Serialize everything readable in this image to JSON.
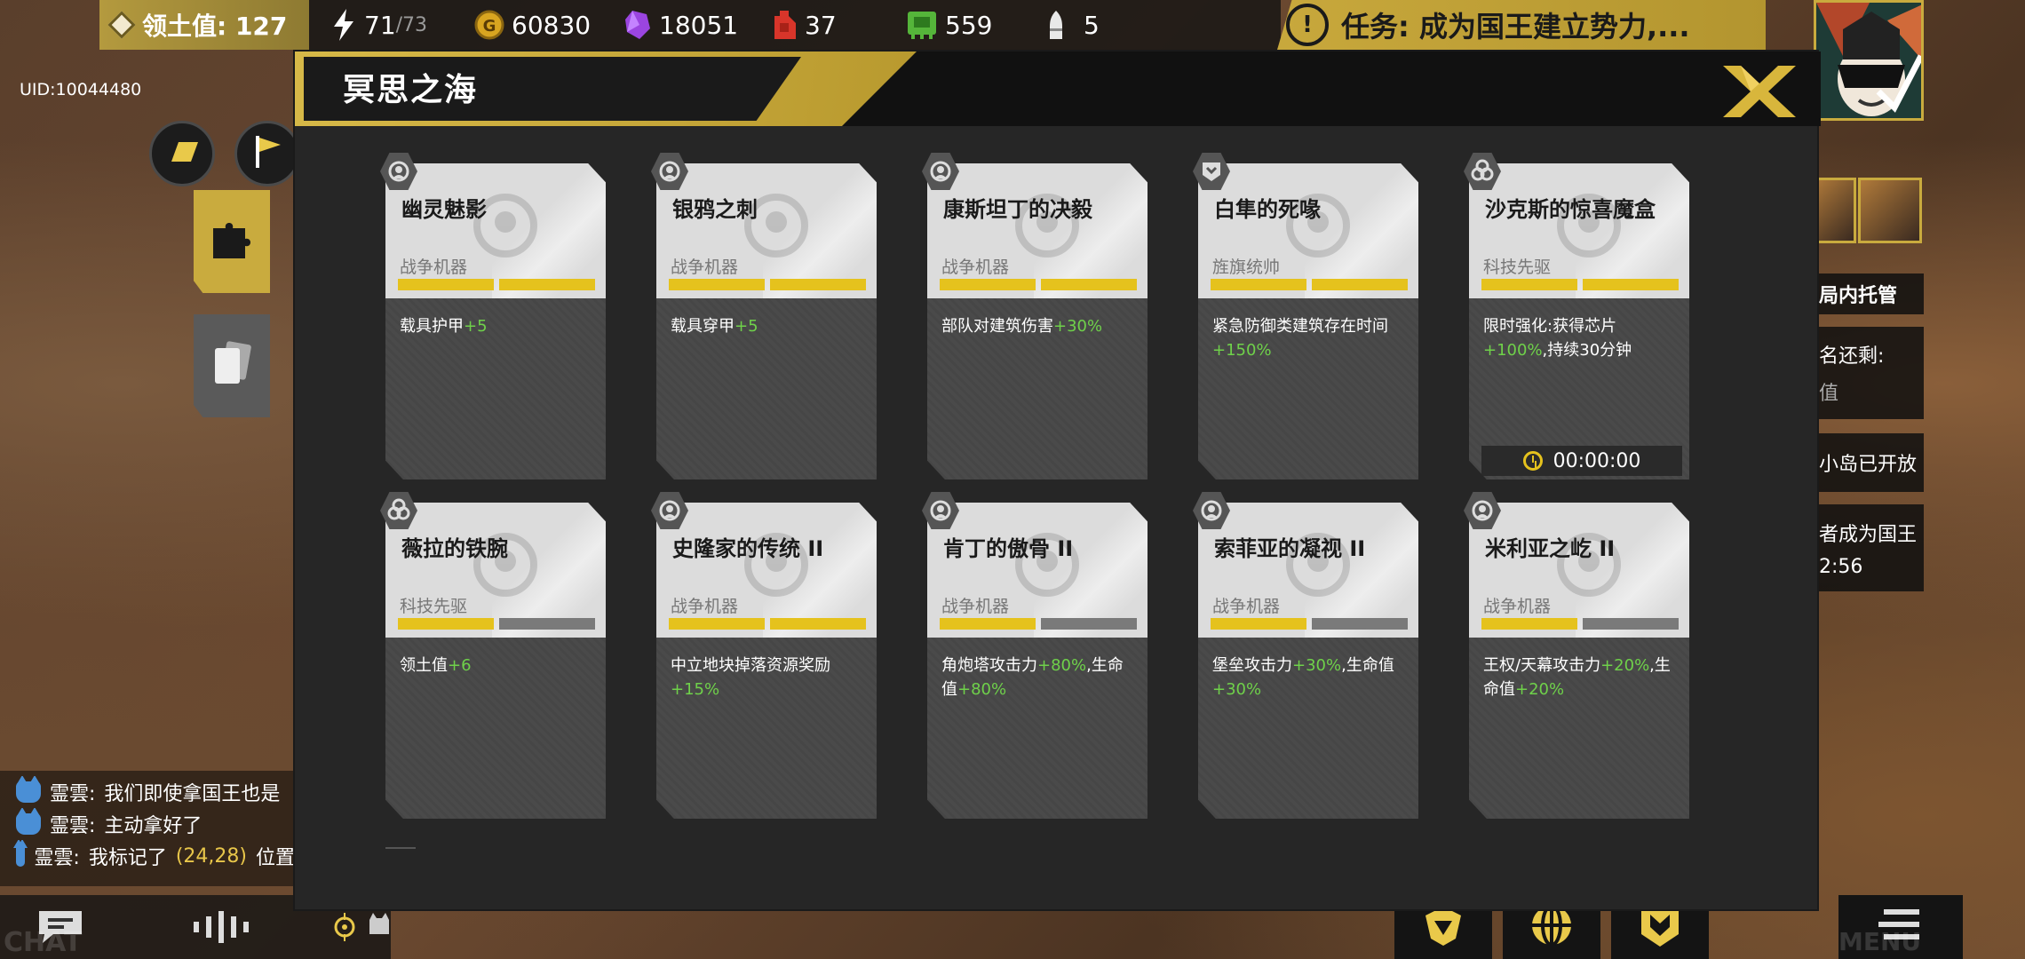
{
  "topbar": {
    "territory_label": "领土值: 127",
    "energy": "71",
    "energy_max": "/73",
    "gold": "60830",
    "crystal": "18051",
    "fuel": "37",
    "chip": "559",
    "ammo": "5",
    "task": "任务: 成为国王建立势力,..."
  },
  "uid": "UID:10044480",
  "chat": [
    {
      "user": "霊雲:",
      "text": "我们即使拿国王也是",
      "highlight": ""
    },
    {
      "user": "霊雲:",
      "text": "主动拿好了",
      "highlight": ""
    },
    {
      "user": "霊雲:",
      "text": "我标记了",
      "highlight": "(24,28)",
      "suffix": "位置"
    }
  ],
  "bottom_left": {
    "chat_label": "CHAT"
  },
  "bottom_right": {
    "menu_label": "MENU"
  },
  "right_panel": {
    "hosting": "局内托管",
    "remaining": "名还剩:",
    "value": "值",
    "island_open": "小岛已开放",
    "become_king": "者成为国王",
    "countdown": "2:56"
  },
  "modal": {
    "title": "冥思之海"
  },
  "cards": [
    {
      "name": "幽灵魅影",
      "type": "战争机器",
      "icon": "gear-bust-icon",
      "level": 2,
      "desc_pre": "载具护甲",
      "bonus": "+5",
      "desc_post": ""
    },
    {
      "name": "银鸦之刺",
      "type": "战争机器",
      "icon": "gear-bust-icon",
      "level": 2,
      "desc_pre": "载具穿甲",
      "bonus": "+5",
      "desc_post": ""
    },
    {
      "name": "康斯坦丁的决毅",
      "type": "战争机器",
      "icon": "gear-bust-icon",
      "level": 2,
      "desc_pre": "部队对建筑伤害",
      "bonus": "+30%",
      "desc_post": ""
    },
    {
      "name": "白隼的死喙",
      "type": "旌旗统帅",
      "icon": "banner-shield-icon",
      "level": 2,
      "desc_pre": "紧急防御类建筑存在时间",
      "bonus": "+150%",
      "desc_post": ""
    },
    {
      "name": "沙克斯的惊喜魔盒",
      "type": "科技先驱",
      "icon": "tech-hex-icon",
      "level": 2,
      "desc_pre": "限时强化:获得芯片",
      "bonus": "+100%",
      "desc_post": ",持续30分钟",
      "timer": "00:00:00"
    },
    {
      "name": "薇拉的铁腕",
      "type": "科技先驱",
      "icon": "tech-hex-icon",
      "level": 1,
      "desc_pre": "领土值",
      "bonus": "+6",
      "desc_post": ""
    },
    {
      "name": "史隆家的传统 II",
      "type": "战争机器",
      "icon": "gear-bust-icon",
      "level": 2,
      "desc_pre": "中立地块掉落资源奖励",
      "bonus": "+15%",
      "desc_post": ""
    },
    {
      "name": "肯丁的傲骨 II",
      "type": "战争机器",
      "icon": "gear-bust-icon",
      "level": 1,
      "desc_pre": "角炮塔攻击力",
      "bonus": "+80%",
      "desc_post": ",生命值",
      "bonus2": "+80%"
    },
    {
      "name": "索菲亚的凝视 II",
      "type": "战争机器",
      "icon": "gear-bust-icon",
      "level": 1,
      "desc_pre": "堡垒攻击力",
      "bonus": "+30%",
      "desc_post": ",生命值",
      "bonus2": "+30%"
    },
    {
      "name": "米利亚之屹 II",
      "type": "战争机器",
      "icon": "gear-bust-icon",
      "level": 1,
      "desc_pre": "王权/天幕攻击力",
      "bonus": "+20%",
      "desc_post": ",生命值",
      "bonus2": "+20%"
    }
  ],
  "colors": {
    "accent": "#e5c21d",
    "bonus": "#6fd14a",
    "title_bar": "#c9ab3e"
  }
}
